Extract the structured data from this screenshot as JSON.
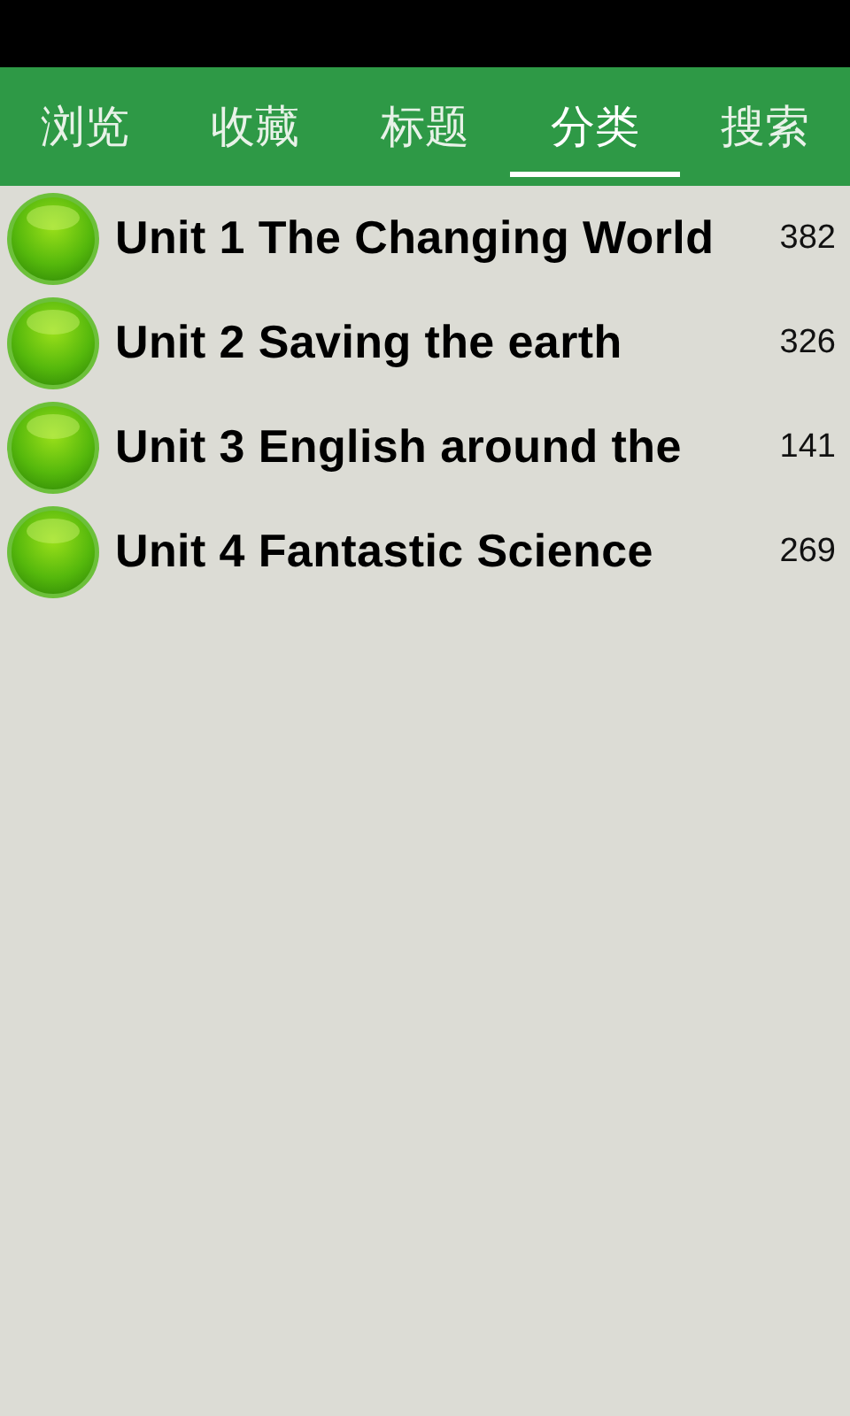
{
  "tabs": [
    {
      "label": "浏览",
      "selected": false
    },
    {
      "label": "收藏",
      "selected": false
    },
    {
      "label": "标题",
      "selected": false
    },
    {
      "label": "分类",
      "selected": true
    },
    {
      "label": "搜索",
      "selected": false
    }
  ],
  "categories": [
    {
      "title": "Unit 1 The Changing World",
      "count": "382"
    },
    {
      "title": "Unit 2 Saving the earth",
      "count": "326"
    },
    {
      "title": "Unit 3 English around the",
      "count": "141"
    },
    {
      "title": "Unit 4 Fantastic Science",
      "count": "269"
    }
  ]
}
